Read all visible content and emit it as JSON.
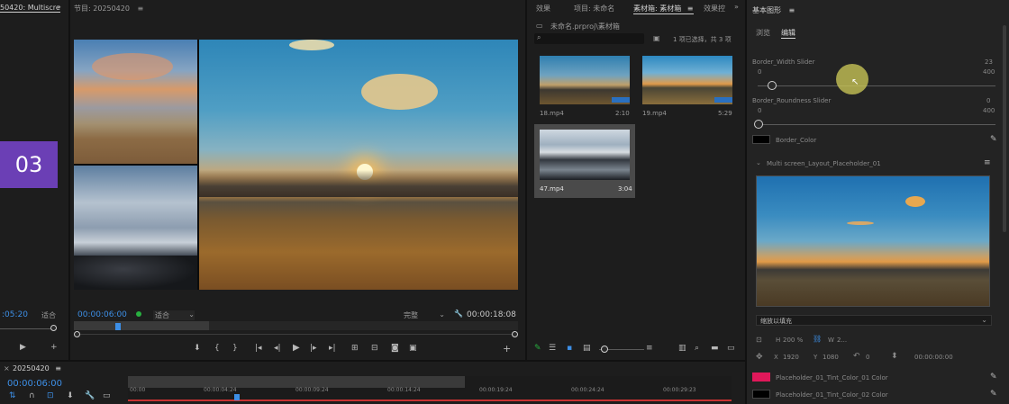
{
  "left_panel": {
    "tab_label": "50420: Multiscre",
    "badge_value": "03",
    "timecode": ":05:20",
    "fit_label": "适合"
  },
  "program": {
    "tab_label": "节目: 20250420",
    "timecode": "00:00:06:00",
    "fit_label": "适合",
    "quality_label": "完整",
    "duration": "00:00:18:08"
  },
  "project": {
    "tab_effects": "效果",
    "tab_project": "项目: 未命名",
    "tab_bin": "素材箱: 素材箱",
    "tab_effects2": "效果控",
    "bin_path": "未命名.prproj\\素材箱",
    "selection_info": "1 项已选择，共 3 项",
    "items": [
      {
        "name": "18.mp4",
        "duration": "2:10"
      },
      {
        "name": "19.mp4",
        "duration": "5:29"
      },
      {
        "name": "47.mp4",
        "duration": "3:04"
      }
    ]
  },
  "essential_graphics": {
    "title": "基本图形",
    "tab_browse": "浏览",
    "tab_edit": "编辑",
    "border_width_label": "Border_Width Slider",
    "border_width_value": "23",
    "border_width_min": "0",
    "border_width_max": "400",
    "border_round_label": "Border_Roundness Slider",
    "border_round_value": "0",
    "border_round_min": "0",
    "border_round_max": "400",
    "border_color_label": "Border_Color",
    "layer_label": "Multi screen_Layout_Placeholder_01",
    "fill_mode": "缩放以填充",
    "h_label": "H",
    "h_value": "200 %",
    "w_label": "W",
    "w_value": "2...",
    "x_label": "X",
    "x_value": "1920",
    "y_label": "Y",
    "y_value": "1080",
    "rot_value": "0",
    "time_value": "00:00:00:00",
    "tint1_label": "Placeholder_01_Tint_Color_01 Color",
    "tint2_label": "Placeholder_01_Tint_Color_02 Color",
    "colors": {
      "tint1": "#e0185a",
      "tint2": "#000000",
      "border": "#000000",
      "badge": "#6b3fb5"
    }
  },
  "timeline": {
    "tab_label": "20250420",
    "timecode": "00:00:06:00",
    "ruler": [
      "00:00",
      "00:00:04:24",
      "00:00:09:24",
      "00:00:14:24",
      "00:00:19:24",
      "00:00:24:24",
      "00:00:29:23"
    ]
  }
}
